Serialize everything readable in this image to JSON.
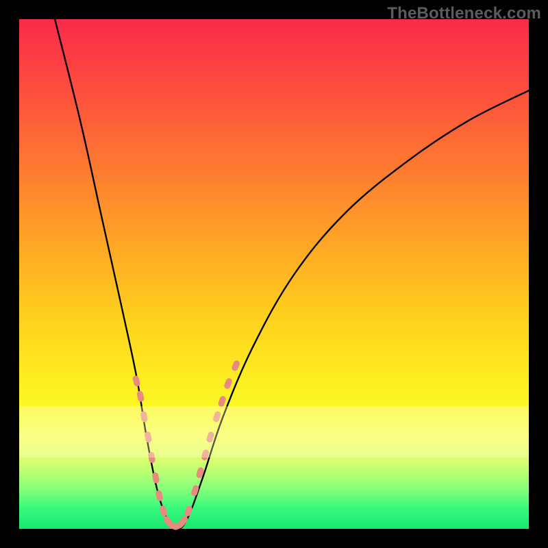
{
  "watermark": "TheBottleneck.com",
  "colors": {
    "curve": "#000000",
    "dot": "#e98a80",
    "gradient_top": "#fb2b49",
    "gradient_bottom": "#17e86f"
  },
  "chart_data": {
    "type": "line",
    "title": "",
    "xlabel": "",
    "ylabel": "",
    "xlim": [
      0,
      100
    ],
    "ylim": [
      0,
      100
    ],
    "grid": false,
    "legend": false,
    "note": "Axes have no visible tick labels; x/y are normalized 0–100 left→right / bottom→top estimates from pixels.",
    "series": [
      {
        "name": "bottleneck-curve",
        "kind": "curve",
        "points": [
          {
            "x": 7,
            "y": 100
          },
          {
            "x": 12,
            "y": 80
          },
          {
            "x": 16,
            "y": 62
          },
          {
            "x": 20,
            "y": 44
          },
          {
            "x": 23,
            "y": 30
          },
          {
            "x": 25,
            "y": 18
          },
          {
            "x": 27,
            "y": 8
          },
          {
            "x": 29,
            "y": 2
          },
          {
            "x": 31,
            "y": 0
          },
          {
            "x": 33,
            "y": 2
          },
          {
            "x": 36,
            "y": 10
          },
          {
            "x": 40,
            "y": 22
          },
          {
            "x": 46,
            "y": 36
          },
          {
            "x": 54,
            "y": 50
          },
          {
            "x": 64,
            "y": 62
          },
          {
            "x": 76,
            "y": 72
          },
          {
            "x": 88,
            "y": 80
          },
          {
            "x": 100,
            "y": 86
          }
        ]
      },
      {
        "name": "dot-cluster",
        "kind": "scatter",
        "note": "Salmon capsule-shaped markers overlaid on curve near the trough.",
        "points": [
          {
            "x": 23.0,
            "y": 29
          },
          {
            "x": 23.8,
            "y": 26
          },
          {
            "x": 24.5,
            "y": 22
          },
          {
            "x": 25.3,
            "y": 18
          },
          {
            "x": 26.0,
            "y": 14
          },
          {
            "x": 26.8,
            "y": 10
          },
          {
            "x": 27.5,
            "y": 6.5
          },
          {
            "x": 28.3,
            "y": 3.5
          },
          {
            "x": 29.2,
            "y": 1.5
          },
          {
            "x": 30.2,
            "y": 0.6
          },
          {
            "x": 31.2,
            "y": 0.6
          },
          {
            "x": 32.2,
            "y": 1.5
          },
          {
            "x": 33.2,
            "y": 3.5
          },
          {
            "x": 34.5,
            "y": 7.5
          },
          {
            "x": 35.5,
            "y": 11
          },
          {
            "x": 36.5,
            "y": 14.5
          },
          {
            "x": 37.5,
            "y": 18
          },
          {
            "x": 38.8,
            "y": 22
          },
          {
            "x": 39.8,
            "y": 25
          },
          {
            "x": 41.0,
            "y": 28.5
          },
          {
            "x": 42.5,
            "y": 32
          }
        ]
      }
    ]
  }
}
